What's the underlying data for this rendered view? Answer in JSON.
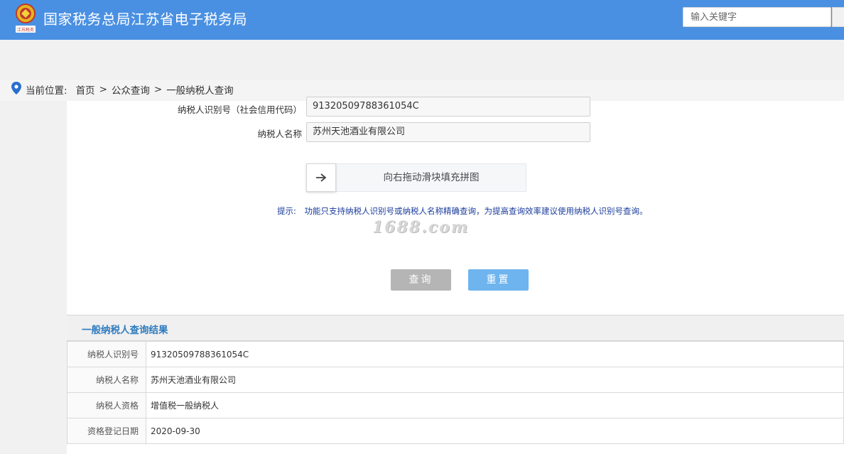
{
  "header": {
    "logo_text": "江苏税务",
    "site_title": "国家税务总局江苏省电子税务局",
    "search_placeholder": "输入关键字"
  },
  "breadcrumb": {
    "label": "当前位置:",
    "items": [
      "首页",
      "公众查询",
      "一般纳税人查询"
    ],
    "separator": ">"
  },
  "form": {
    "taxpayer_id_label": "纳税人识别号（社会信用代码）",
    "taxpayer_id_value": "91320509788361054C",
    "taxpayer_name_label": "纳税人名称",
    "taxpayer_name_value": "苏州天池酒业有限公司",
    "slider_text": "向右拖动滑块填充拼图",
    "tip_label": "提示:",
    "tip_text": "功能只支持纳税人识别号或纳税人名称精确查询，为提高查询效率建议使用纳税人识别号查询。",
    "watermark": "1688.com",
    "query_button": "查询",
    "reset_button": "重置"
  },
  "result": {
    "title": "一般纳税人查询结果",
    "rows": [
      {
        "label": "纳税人识别号",
        "value": "91320509788361054C"
      },
      {
        "label": "纳税人名称",
        "value": "苏州天池酒业有限公司"
      },
      {
        "label": "纳税人资格",
        "value": "增值税一般纳税人"
      },
      {
        "label": "资格登记日期",
        "value": "2020-09-30"
      }
    ]
  },
  "colors": {
    "header_bg": "#4a90e2",
    "result_title": "#2e7bbf",
    "tip_text": "#1a3c9c",
    "query_button": "#b5b5b5",
    "reset_button": "#6eb4ee"
  }
}
